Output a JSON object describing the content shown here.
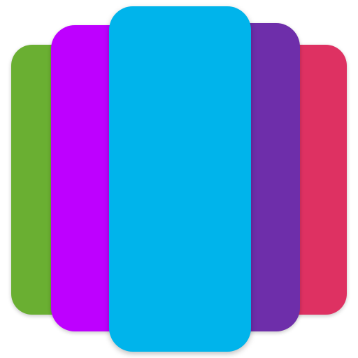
{
  "icon": {
    "name": "wallpaper-color-cards-icon",
    "cards": [
      {
        "id": "green",
        "color": "#6AAF32"
      },
      {
        "id": "red",
        "color": "#DE3162"
      },
      {
        "id": "magenta",
        "color": "#BE00FF"
      },
      {
        "id": "purple",
        "color": "#6E2EAA"
      },
      {
        "id": "cyan",
        "color": "#00B4EB"
      }
    ]
  }
}
